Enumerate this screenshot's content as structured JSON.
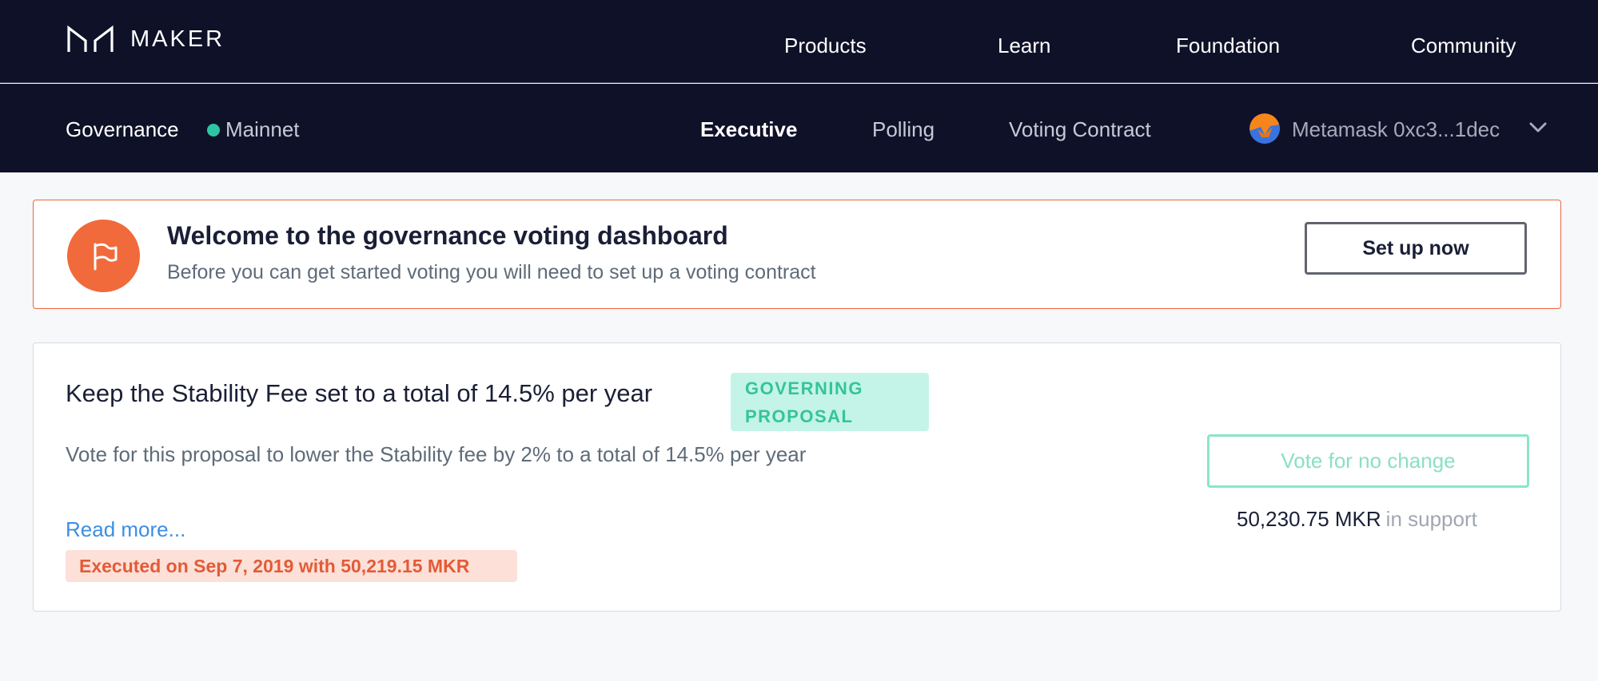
{
  "topnav": {
    "brand": "MAKER",
    "links": [
      "Products",
      "Learn",
      "Foundation",
      "Community"
    ]
  },
  "subnav": {
    "section": "Governance",
    "network": "Mainnet",
    "network_status_color": "#2ec5a3",
    "tabs": [
      {
        "label": "Executive",
        "active": true
      },
      {
        "label": "Polling",
        "active": false
      },
      {
        "label": "Voting Contract",
        "active": false
      }
    ],
    "wallet": {
      "label": "Metamask 0xc3...1dec",
      "icon": "metamask-fox-icon"
    }
  },
  "banner": {
    "icon": "flag-icon",
    "title": "Welcome to the governance voting dashboard",
    "subtitle": "Before you can get started voting you will need to set up a voting contract",
    "button_label": "Set up now",
    "accent_color": "#f06a3b"
  },
  "proposal": {
    "title": "Keep the Stability Fee set to a total of 14.5% per year",
    "tag": "GOVERNING PROPOSAL",
    "description": "Vote for this proposal to lower the Stability fee by 2% to a total of 14.5% per year",
    "read_more": "Read more...",
    "executed": "Executed on Sep 7, 2019 with 50,219.15 MKR",
    "vote_button": "Vote for no change",
    "support_amount": "50,230.75 MKR",
    "support_label": "in support"
  }
}
